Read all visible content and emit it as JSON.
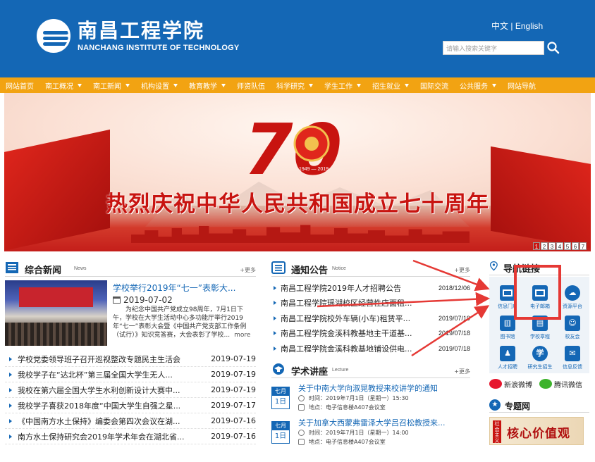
{
  "header": {
    "logo_cn": "南昌工程学院",
    "logo_en": "NANCHANG INSTITUTE OF TECHNOLOGY",
    "lang_cn": "中文",
    "lang_sep": "|",
    "lang_en": "English",
    "search_placeholder": "请输入搜索关键字"
  },
  "nav": {
    "items": [
      {
        "label": "网站首页",
        "dropdown": false
      },
      {
        "label": "南工概况",
        "dropdown": true
      },
      {
        "label": "南工新闻",
        "dropdown": true
      },
      {
        "label": "机构设置",
        "dropdown": true
      },
      {
        "label": "教育教学",
        "dropdown": true
      },
      {
        "label": "师资队伍",
        "dropdown": false
      },
      {
        "label": "科学研究",
        "dropdown": true
      },
      {
        "label": "学生工作",
        "dropdown": true
      },
      {
        "label": "招生就业",
        "dropdown": true
      },
      {
        "label": "国际交流",
        "dropdown": false
      },
      {
        "label": "公共服务",
        "dropdown": true
      },
      {
        "label": "网站导航",
        "dropdown": false
      }
    ]
  },
  "banner": {
    "seventy": "70",
    "years": "1949 — 2019",
    "slogan": "热烈庆祝中华人民共和国成立七十周年",
    "pages": [
      "1",
      "2",
      "3",
      "4",
      "5",
      "6",
      "7"
    ],
    "active_page": "1"
  },
  "news": {
    "title": "综合新闻",
    "title_en": "News",
    "more": "+更多",
    "feature": {
      "title": "学校举行2019年“七一”表彰大...",
      "date": "2019-07-02",
      "body": "为纪念中国共产党成立98周年，7月1日下午，学校在大学生活动中心多功能厅举行2019年“七一”表彰大会暨《中国共产党支部工作条例（试行）》知识竞答赛，大会表彰了学校...",
      "more": "more"
    },
    "items": [
      {
        "title": "学校党委领导班子召开巡视整改专题民主生活会",
        "date": "2019-07-19"
      },
      {
        "title": "我校学子在“达北杯”第三届全国大学生无人...",
        "date": "2019-07-19"
      },
      {
        "title": "我校在第六届全国大学生水利创新设计大赛中...",
        "date": "2019-07-19"
      },
      {
        "title": "我校学子喜获2018年度“中国大学生自强之星...",
        "date": "2019-07-17"
      },
      {
        "title": "《中国南方水土保持》编委会第四次会议在湖...",
        "date": "2019-07-16"
      },
      {
        "title": "南方水土保持研究会2019年学术年会在湖北省...",
        "date": "2019-07-16"
      }
    ]
  },
  "notice": {
    "title": "通知公告",
    "title_en": "Notice",
    "more": "+更多",
    "items": [
      {
        "title": "南昌工程学院2019年人才招聘公告",
        "date": "2018/12/06"
      },
      {
        "title": "南昌工程学院瑶湖校区经营性店面租...",
        "date": ""
      },
      {
        "title": "南昌工程学院校外车辆(小车)租赁平...",
        "date": "2019/07/19"
      },
      {
        "title": "南昌工程学院金溪科教基地主干道基...",
        "date": "2019/07/18"
      },
      {
        "title": "南昌工程学院金溪科教基地铺设供电...",
        "date": "2019/07/18"
      }
    ]
  },
  "lecture": {
    "title": "学术讲座",
    "title_en": "Lecture",
    "more": "+更多",
    "items": [
      {
        "month": "七月",
        "day": "1日",
        "title": "关于中南大学向淑晃教授来校讲学的通知",
        "time_label": "时间：",
        "time": "2019年7月1日（星期一）15:30",
        "place_label": "地点：",
        "place": "电子信息楼A407会议室"
      },
      {
        "month": "七月",
        "day": "1日",
        "title": "关于加拿大西蒙弗雷泽大学吕召松教授来...",
        "time_label": "时间：",
        "time": "2019年7月1日（星期一）14:00",
        "place_label": "地点：",
        "place": "电子信息楼A407会议室"
      }
    ]
  },
  "quick_links": {
    "title": "导航链接",
    "items": [
      {
        "label": "信息门户",
        "icon": "envelope-icon"
      },
      {
        "label": "电子邮箱",
        "icon": "envelope-icon"
      },
      {
        "label": "资源平台",
        "icon": "cloud-icon"
      },
      {
        "label": "图书馆",
        "icon": "library-icon"
      },
      {
        "label": "学校章程",
        "icon": "document-icon"
      },
      {
        "label": "校友会",
        "icon": "alumni-icon"
      },
      {
        "label": "人才招聘",
        "icon": "person-icon"
      },
      {
        "label": "研究生招生",
        "icon": "graduate-icon"
      },
      {
        "label": "信息反馈",
        "icon": "feedback-icon"
      }
    ]
  },
  "social": {
    "weibo": "新浪微博",
    "wechat": "腾讯微信"
  },
  "topics": {
    "title": "专题网",
    "banner_side": "社会主义",
    "banner_text": "核心价值观"
  },
  "colors": {
    "header_blue": "#1467b5",
    "nav_orange": "#f2a312",
    "banner_red": "#c81410",
    "annotation_red": "#e53935"
  }
}
